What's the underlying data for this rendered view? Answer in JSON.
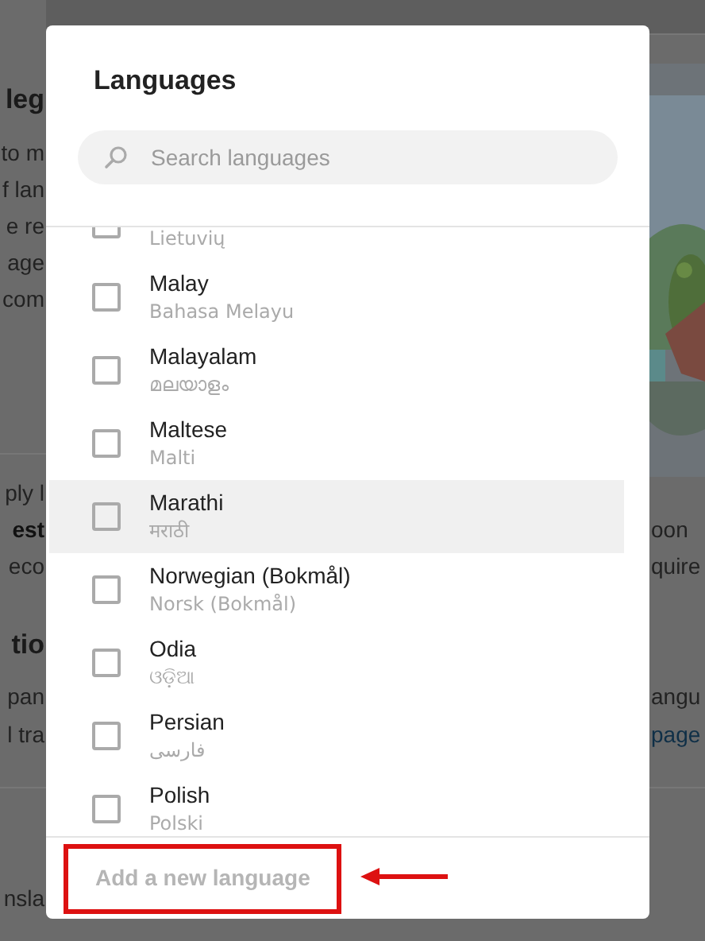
{
  "background_page": {
    "left_fragments": [
      {
        "kind": "heading",
        "text": "leg"
      },
      {
        "kind": "text",
        "text": "to m"
      },
      {
        "kind": "text",
        "text": "f lan"
      },
      {
        "kind": "text",
        "text": "e re"
      },
      {
        "kind": "text",
        "text": "age"
      },
      {
        "kind": "text",
        "text": "com"
      },
      {
        "kind": "text",
        "text": "ply l"
      },
      {
        "kind": "bold",
        "text": "est"
      },
      {
        "kind": "text",
        "text": "eco"
      },
      {
        "kind": "heading",
        "text": "tio"
      },
      {
        "kind": "text",
        "text": "pan"
      },
      {
        "kind": "text",
        "text": "l tra"
      },
      {
        "kind": "text",
        "text": "nsla"
      }
    ],
    "right_fragments": [
      {
        "kind": "text",
        "text": "oon"
      },
      {
        "kind": "text",
        "text": "quire"
      },
      {
        "kind": "text",
        "text": "angu"
      },
      {
        "kind": "link",
        "text": "page"
      }
    ]
  },
  "dialog": {
    "title": "Languages",
    "search": {
      "placeholder": "Search languages"
    },
    "languages": [
      {
        "native": "Lietuvių",
        "checked": false,
        "hovered": false
      },
      {
        "name": "Malay",
        "native": "Bahasa Melayu",
        "checked": false,
        "hovered": false
      },
      {
        "name": "Malayalam",
        "native": "മലയാളം",
        "checked": false,
        "hovered": false
      },
      {
        "name": "Maltese",
        "native": "Malti",
        "checked": false,
        "hovered": false
      },
      {
        "name": "Marathi",
        "native": "मराठी",
        "checked": false,
        "hovered": true
      },
      {
        "name": "Norwegian (Bokmål)",
        "native": "Norsk (Bokmål)",
        "checked": false,
        "hovered": false
      },
      {
        "name": "Odia",
        "native": "ଓଡ଼ିଆ",
        "checked": false,
        "hovered": false
      },
      {
        "name": "Persian",
        "native": "فارسی",
        "checked": false,
        "hovered": false
      },
      {
        "name": "Polish",
        "native": "Polski",
        "checked": false,
        "hovered": false
      }
    ],
    "add_button": {
      "label": "Add a new language",
      "disabled": true,
      "highlighted": true
    }
  }
}
